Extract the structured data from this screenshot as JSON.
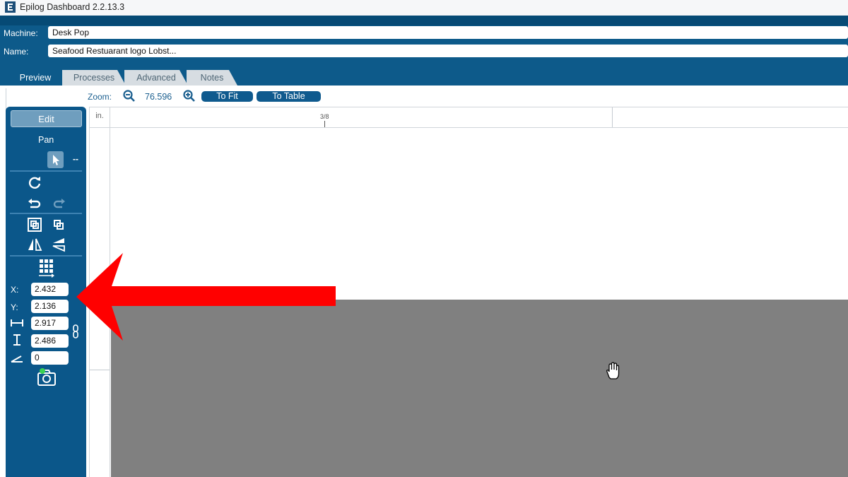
{
  "window": {
    "title": "Epilog Dashboard 2.2.13.3"
  },
  "header": {
    "machine_label": "Machine:",
    "machine_value": "Desk Pop",
    "name_label": "Name:",
    "name_value": "Seafood Restuarant logo Lobst..."
  },
  "tabs": [
    {
      "label": "Preview",
      "active": true
    },
    {
      "label": "Processes",
      "active": false
    },
    {
      "label": "Advanced",
      "active": false
    },
    {
      "label": "Notes",
      "active": false
    }
  ],
  "zoom": {
    "label": "Zoom:",
    "value": "76.596",
    "fit_button": "To Fit",
    "table_button": "To Table",
    "zoom_out_icon": "zoom-out-icon",
    "zoom_in_icon": "zoom-in-icon"
  },
  "tools": {
    "edit_button": "Edit",
    "pan_label": "Pan",
    "pointer_icon": "pointer-icon",
    "dash": "--",
    "icons": [
      "refresh-icon",
      "undo-icon",
      "redo-icon",
      "group-icon",
      "ungroup-icon",
      "flip-horizontal-icon",
      "flip-vertical-icon",
      "align-grid-icon",
      "lock-aspect-icon",
      "camera-icon"
    ]
  },
  "coords": {
    "x_label": "X:",
    "x_value": "2.432",
    "y_label": "Y:",
    "y_value": "2.136",
    "width_value": "2.917",
    "height_value": "2.486",
    "angle_value": "0"
  },
  "ruler": {
    "unit": "in.",
    "top_tick_label": "3/8"
  },
  "overlay": {
    "arrow_color": "#ff0000",
    "cursor_icon": "hand-cursor-icon"
  },
  "colors": {
    "brand": "#0d5a8a",
    "panel": "#0b578a",
    "canvas_gray": "#808080"
  }
}
